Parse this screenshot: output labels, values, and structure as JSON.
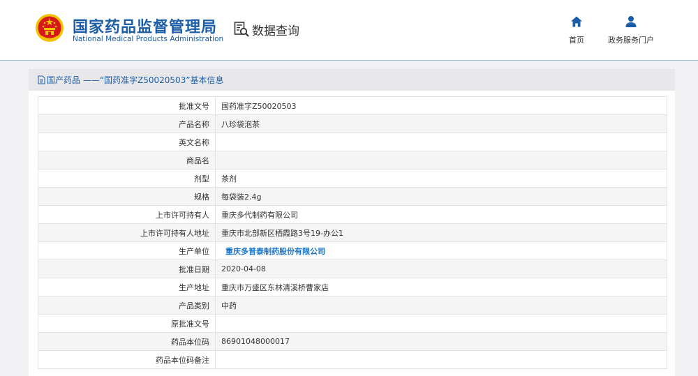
{
  "header": {
    "brand_cn": "国家药品监督管理局",
    "brand_en": "National Medical Products Administration",
    "data_query": "数据查询",
    "nav": [
      {
        "label": "首页",
        "icon": "home-icon"
      },
      {
        "label": "政务服务门户",
        "icon": "user-icon"
      }
    ]
  },
  "panel": {
    "title": "国产药品 ——“国药准字Z50020503”基本信息"
  },
  "rows": [
    {
      "label": "批准文号",
      "value": "国药准字Z50020503"
    },
    {
      "label": "产品名称",
      "value": "八珍袋泡茶"
    },
    {
      "label": "英文名称",
      "value": ""
    },
    {
      "label": "商品名",
      "value": ""
    },
    {
      "label": "剂型",
      "value": "茶剂"
    },
    {
      "label": "规格",
      "value": "每袋装2.4g"
    },
    {
      "label": "上市许可持有人",
      "value": "重庆多代制药有限公司"
    },
    {
      "label": "上市许可持有人地址",
      "value": "重庆市北部新区栖霞路3号19-办公1"
    },
    {
      "label": "生产单位",
      "value": "重庆多普泰制药股份有限公司"
    },
    {
      "label": "批准日期",
      "value": "2020-04-08"
    },
    {
      "label": "生产地址",
      "value": "重庆市万盛区东林清溪桥曹家店"
    },
    {
      "label": "产品类别",
      "value": "中药"
    },
    {
      "label": "原批准文号",
      "value": ""
    },
    {
      "label": "药品本位码",
      "value": "86901048000017"
    },
    {
      "label": "药品本位码备注",
      "value": ""
    }
  ],
  "colors": {
    "brand_blue": "#1c5ea8",
    "link_blue": "#1a73c8",
    "emblem_red": "#d7191c",
    "emblem_gold": "#f2c200"
  }
}
